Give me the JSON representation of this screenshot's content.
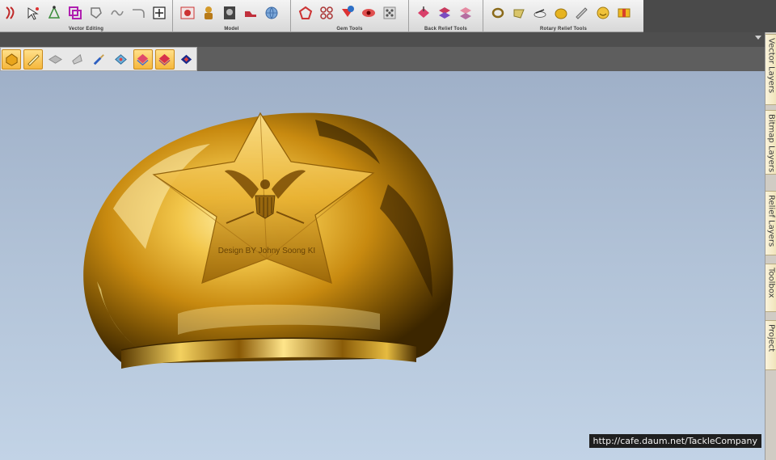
{
  "toolbar": {
    "groups": [
      {
        "label": "Vector Editing",
        "icons": [
          "node-edit-icon",
          "smart-select-icon",
          "bezier-icon",
          "weld-icon",
          "offset-icon",
          "trim-icon",
          "fillet-icon",
          "transform-icon"
        ]
      },
      {
        "label": "Model",
        "icons": [
          "model-relief-icon",
          "model-figure-icon",
          "model-bitmap-icon",
          "model-shoe-icon",
          "model-globe-icon"
        ]
      },
      {
        "label": "Gem Tools",
        "icons": [
          "gem-outline-icon",
          "gem-cluster-icon",
          "gem-info-icon",
          "gem-eye-icon",
          "gem-pave-icon"
        ]
      },
      {
        "label": "Back Relief Tools",
        "icons": [
          "back-relief-add-icon",
          "back-relief-stack-icon",
          "back-relief-split-icon"
        ]
      },
      {
        "label": "Rotary Relief Tools",
        "icons": [
          "rotary-ring-icon",
          "rotary-wrap-icon",
          "rotary-shank-icon",
          "rotary-gold-icon",
          "rotary-pen-icon",
          "rotary-smile-icon",
          "rotary-bar-icon"
        ]
      }
    ]
  },
  "viewbar": {
    "icons": [
      {
        "name": "shade-gold-icon",
        "active": true
      },
      {
        "name": "ruler-pen-icon",
        "active": true
      },
      {
        "name": "plane-grey-icon",
        "active": false
      },
      {
        "name": "plane-angle-icon",
        "active": false
      },
      {
        "name": "brush-paint-icon",
        "active": false
      },
      {
        "name": "layer-diamond-icon",
        "active": false
      },
      {
        "name": "relief-layer-icon",
        "active": true
      },
      {
        "name": "relief-red-icon",
        "active": true
      },
      {
        "name": "relief-navy-icon",
        "active": false
      }
    ]
  },
  "viewport": {
    "engraving": "Design BY Johny Soong KI",
    "watermark": "http://cafe.daum.net/TackleCompany"
  },
  "sidetabs": [
    {
      "label": "Vector Layers"
    },
    {
      "label": "Bitmap Layers"
    },
    {
      "label": "Relief Layers"
    },
    {
      "label": "Toolbox"
    },
    {
      "label": "Project"
    }
  ],
  "colors": {
    "gold_light": "#ffe89a",
    "gold_mid": "#d9a21c",
    "gold_dark": "#5a3b02",
    "accent_active": "#f6b73c"
  }
}
